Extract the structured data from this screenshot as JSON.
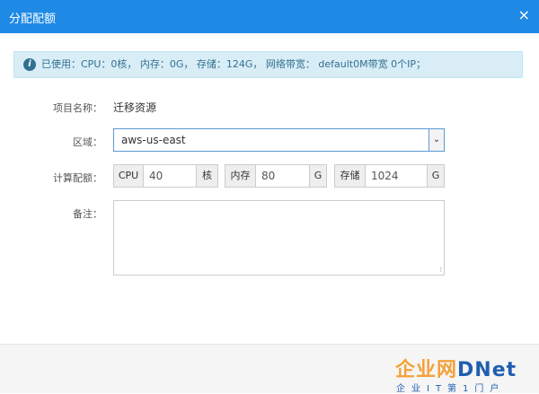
{
  "dialog": {
    "title": "分配配额",
    "close_glyph": "×"
  },
  "info": {
    "icon_glyph": "i",
    "text": "已使用：CPU：0核，     内存：0G，     存储：124G，     网络带宽：  default0M带宽 0个IP；"
  },
  "form": {
    "project": {
      "label": "项目名称：",
      "value": "迁移资源"
    },
    "region": {
      "label": "区域：",
      "value": "aws-us-east",
      "arrow_glyph": "⌄"
    },
    "compute": {
      "label": "计算配额：",
      "cpu": {
        "prefix": "CPU",
        "value": "40",
        "unit": "核"
      },
      "memory": {
        "prefix": "内存",
        "value": "80",
        "unit": "G"
      },
      "storage": {
        "prefix": "存储",
        "value": "1024",
        "unit": "G"
      }
    },
    "remarks": {
      "label": "备注：",
      "value": "",
      "grip_glyph": "⁞"
    }
  },
  "watermark": {
    "brand_left": "企业网",
    "brand_right": "DNet",
    "tagline": "企业IT第1门户"
  }
}
